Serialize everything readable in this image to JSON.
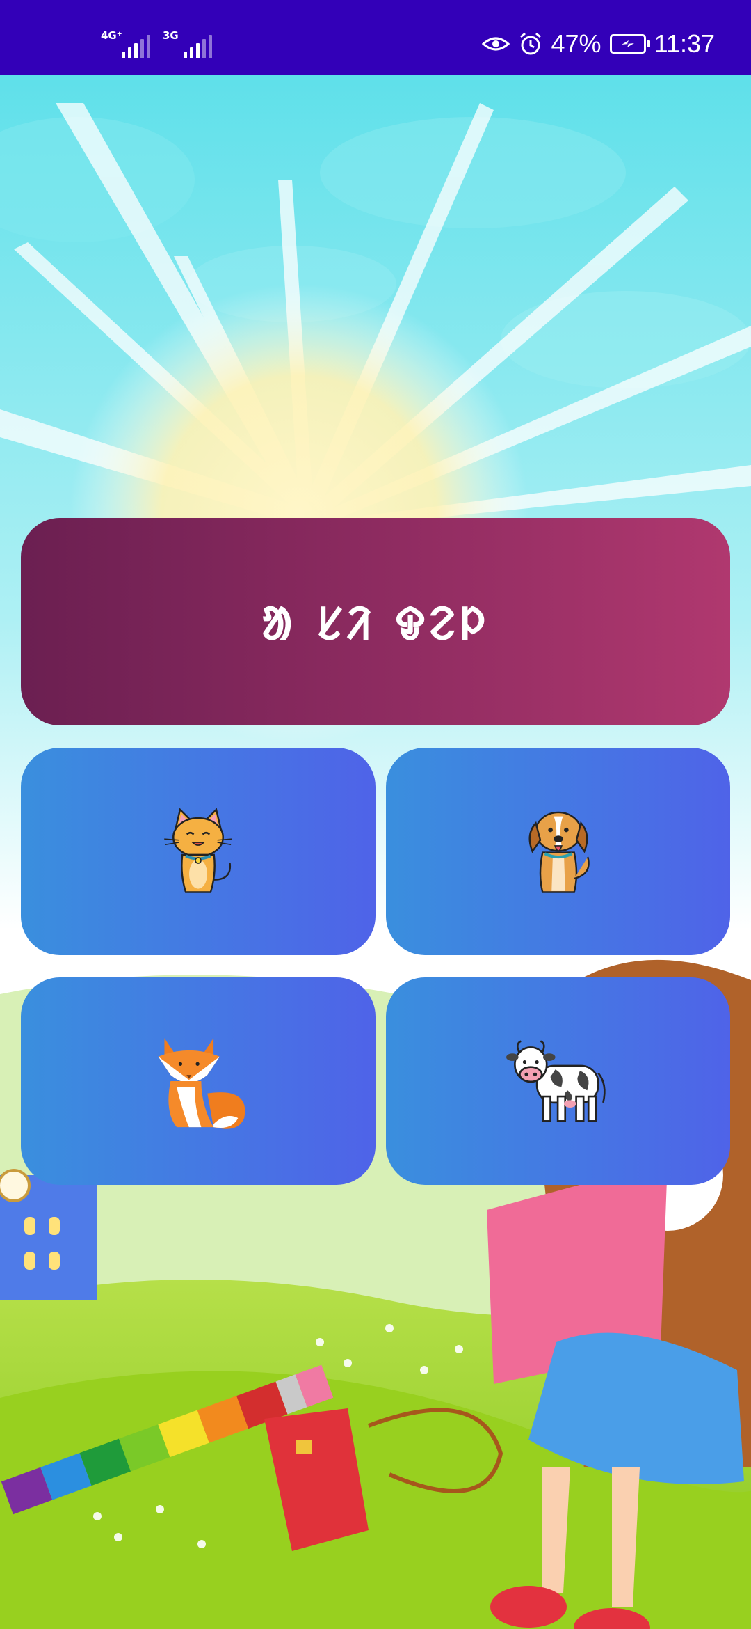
{
  "status_bar": {
    "network_1": "4G⁺",
    "network_2": "3G",
    "battery_percent": "47%",
    "time": "11:37",
    "icons": [
      "eye-icon",
      "alarm-icon",
      "battery-charging-icon"
    ]
  },
  "title_card": {
    "text": "ᱟ ᱥᱤ ᱫᱮᱞ"
  },
  "animals": [
    {
      "name": "cat",
      "icon": "cat-icon"
    },
    {
      "name": "dog",
      "icon": "dog-icon"
    },
    {
      "name": "fox",
      "icon": "fox-icon"
    },
    {
      "name": "cow",
      "icon": "cow-icon"
    }
  ],
  "colors": {
    "status_bar": "#3300b8",
    "title_gradient_start": "#6b1f51",
    "title_gradient_end": "#b0386f",
    "tile_gradient_start": "#3a8fde",
    "tile_gradient_end": "#4f63e8"
  }
}
